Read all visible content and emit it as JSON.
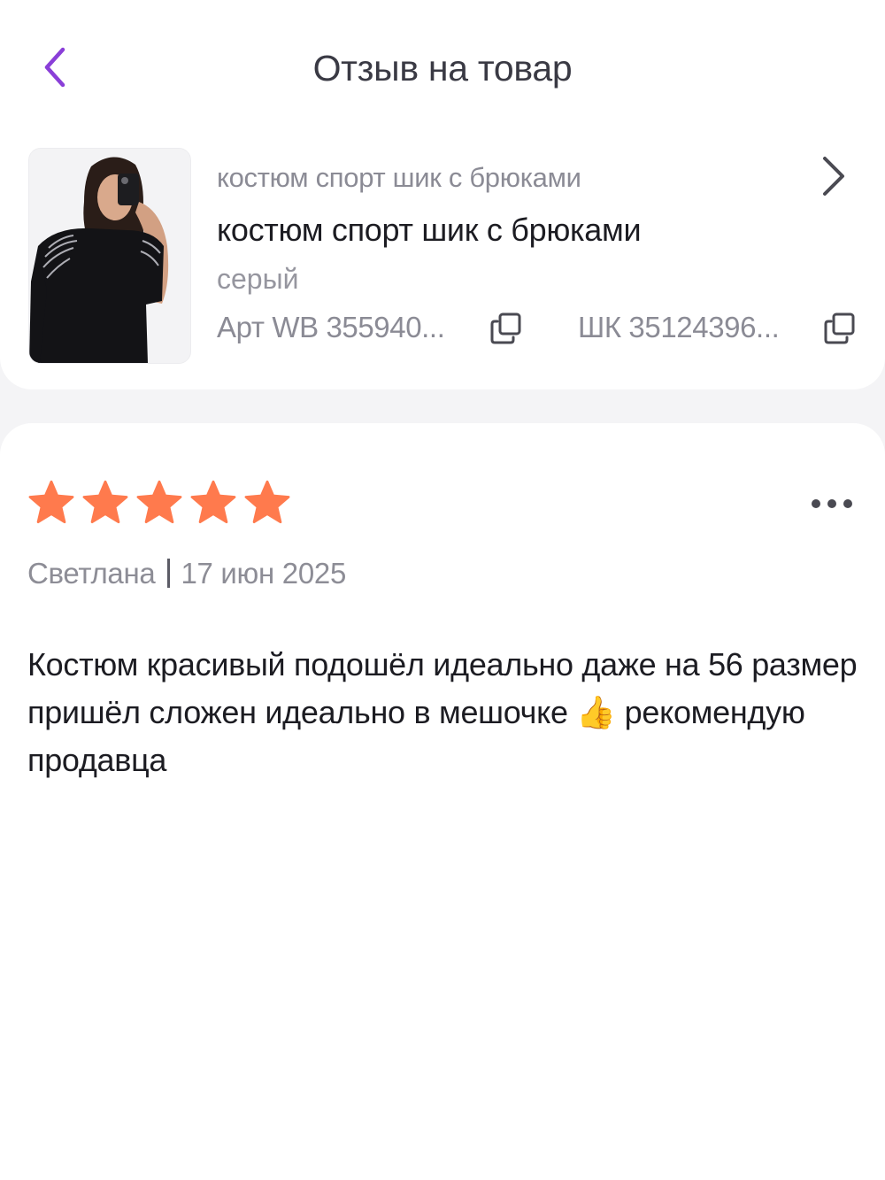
{
  "header": {
    "title": "Отзыв на товар",
    "back_icon": "chevron-left-icon",
    "accent_color": "#8a3fd8"
  },
  "product": {
    "brand": "костюм спорт шик с брюками",
    "name": "костюм спорт шик с брюками",
    "color": "серый",
    "article": "Арт WB 355940...",
    "barcode": "ШК 35124396...",
    "copy_icon": "copy-icon",
    "open_icon": "chevron-right-icon",
    "image": "product-photo"
  },
  "review": {
    "rating": 5,
    "rating_max": 5,
    "star_color": "#ff7a4d",
    "author": "Светлана",
    "date": "17 июн 2025",
    "text": "Костюм красивый подошёл идеально даже на 56 размер пришёл сложен идеально в мешочке 👍 рекомендую продавца",
    "more_icon": "more-horizontal-icon"
  }
}
